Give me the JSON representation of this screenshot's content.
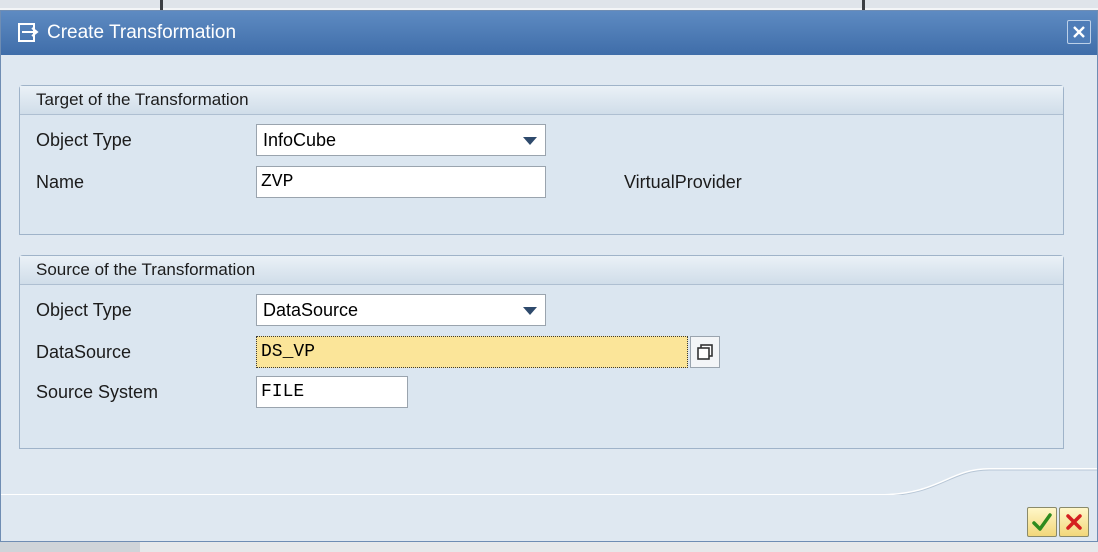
{
  "dialog": {
    "title": "Create Transformation"
  },
  "target_group": {
    "header": "Target of the Transformation",
    "object_type_label": "Object Type",
    "object_type_value": "InfoCube",
    "name_label": "Name",
    "name_value": "ZVP",
    "name_description": "VirtualProvider"
  },
  "source_group": {
    "header": "Source of the Transformation",
    "object_type_label": "Object Type",
    "object_type_value": "DataSource",
    "datasource_label": "DataSource",
    "datasource_value": "DS_VP",
    "source_system_label": "Source System",
    "source_system_value": "FILE"
  },
  "colors": {
    "titlebar": "#4a78b3",
    "focused_field": "#fbe599",
    "ok_check": "#2e8b1e",
    "cancel_x": "#d42020"
  },
  "icons": {
    "title": "create-transformation-icon",
    "close": "close-icon",
    "f4_help": "value-help-icon",
    "ok": "checkmark-icon",
    "cancel": "cancel-x-icon"
  }
}
